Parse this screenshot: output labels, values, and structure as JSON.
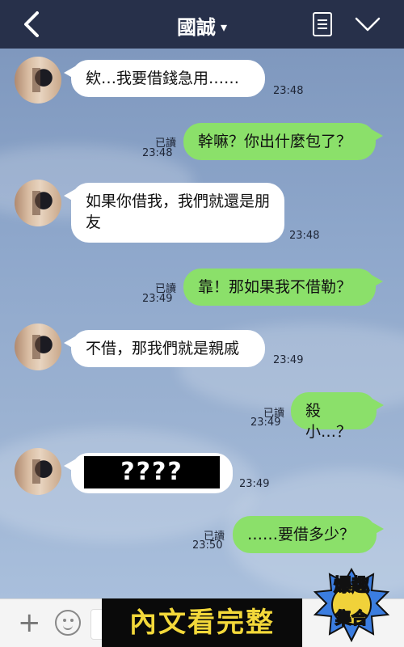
{
  "header": {
    "title": "國誠",
    "caret": "▾",
    "back_icon": "chevron-left-icon",
    "menu_icon": "note-icon",
    "collapse_icon": "chevron-down-icon"
  },
  "messages": [
    {
      "side": "left",
      "text": "欸…我要借錢急用……",
      "time": "23:48"
    },
    {
      "side": "right",
      "text": "幹嘛？你出什麼包了？",
      "read": "已讀",
      "time": "23:48"
    },
    {
      "side": "left",
      "text": "如果你借我，我們就還是朋友",
      "time": "23:48"
    },
    {
      "side": "right",
      "text": "靠！那如果我不借勒？",
      "read": "已讀",
      "time": "23:49"
    },
    {
      "side": "left",
      "text": "不借，那我們就是親戚",
      "time": "23:49"
    },
    {
      "side": "right",
      "text": "殺小…？",
      "read": "已讀",
      "time": "23:49"
    },
    {
      "side": "left",
      "text": "????",
      "time": "23:49"
    },
    {
      "side": "right",
      "text": "……要借多少？",
      "read": "已讀",
      "time": "23:50"
    }
  ],
  "bottom": {
    "banner": "內文看完整",
    "badge_line1": "爆趣",
    "badge_line2": "集合"
  },
  "colors": {
    "header_bg": "#27304a",
    "outgoing_bubble": "#8be06a",
    "incoming_bubble": "#ffffff",
    "banner_text": "#f3d83a"
  }
}
